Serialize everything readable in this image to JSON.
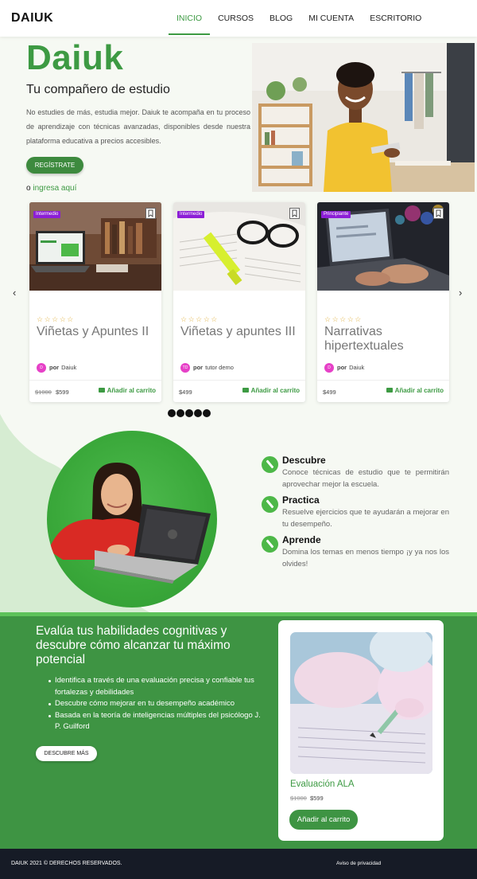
{
  "header": {
    "logo": "DAIUK",
    "nav": [
      "INICIO",
      "CURSOS",
      "BLOG",
      "MI CUENTA",
      "ESCRITORIO"
    ],
    "active_index": 0,
    "accent_color": "#3d9a43"
  },
  "hero": {
    "title": "Daiuk",
    "subtitle": "Tu compañero de estudio",
    "text": "No estudies de más, estudia mejor. Daiuk te acompaña en tu proceso de aprendizaje con técnicas avanzadas, disponibles desde nuestra plataforma educativa a precios accesibles.",
    "register_label": "REGÍSTRATE",
    "login_prefix": "o",
    "login_link": "ingresa aquí"
  },
  "courses": {
    "prev_arrow": "‹",
    "next_arrow": "›",
    "stars": "☆☆☆☆☆",
    "author_prefix": "por",
    "cart_label": "Añadir al carrito",
    "items": [
      {
        "level": "Intermedio",
        "title": "Viñetas y Apuntes II",
        "author": "Daiuk",
        "author_initial": "D",
        "old_price": "$1000",
        "price": "$599"
      },
      {
        "level": "Intermedio",
        "title": "Viñetas y apuntes III",
        "author": "tutor demo",
        "author_initial": "TD",
        "old_price": "",
        "price": "$499"
      },
      {
        "level": "Principiante",
        "title": "Narrativas hipertextuales",
        "author": "Daiuk",
        "author_initial": "D",
        "old_price": "",
        "price": "$499"
      }
    ],
    "carousel_dots": 5
  },
  "features": [
    {
      "title": "Descubre",
      "text": "Conoce técnicas de estudio que te permitirán aprovechar mejor la escuela."
    },
    {
      "title": "Practica",
      "text": "Resuelve ejercicios que te ayudarán a mejorar en tu desempeño."
    },
    {
      "title": "Aprende",
      "text": "Domina los temas en menos tiempo ¡y ya nos los olvides!"
    }
  ],
  "evaluation": {
    "title": "Evalúa tus habilidades cognitivas y descubre cómo alcanzar tu máximo potencial",
    "bullets": [
      "Identifica a través de una evaluación precisa y confiable tus fortalezas y debilidades",
      "Descubre cómo mejorar en tu desempeño académico",
      "Basada en la teoría de inteligencias múltiples del psicólogo J. P. Guilford"
    ],
    "button": "DESCUBRE MÁS",
    "card_title": "Evaluación ALA",
    "old_price": "$1000",
    "price": "$599",
    "card_button": "Añadir al carrito"
  },
  "footer": {
    "copyright": "DAIUK 2021 © DERECHOS RESERVADOS.",
    "privacy": "Aviso de privacidad"
  }
}
